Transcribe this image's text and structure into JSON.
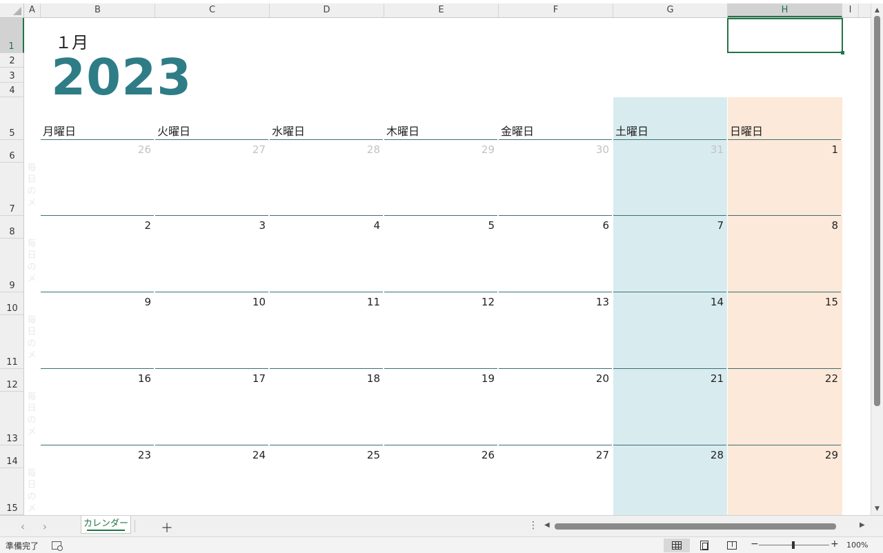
{
  "columns": [
    "A",
    "B",
    "C",
    "D",
    "E",
    "F",
    "G",
    "H",
    "I"
  ],
  "selected_column": "H",
  "rows": [
    "1",
    "2",
    "3",
    "4",
    "5",
    "6",
    "7",
    "8",
    "9",
    "10",
    "11",
    "12",
    "13",
    "14",
    "15"
  ],
  "selected_row": "1",
  "calendar": {
    "month": "１月",
    "year": "2023",
    "weekdays": [
      "月曜日",
      "火曜日",
      "水曜日",
      "木曜日",
      "金曜日",
      "土曜日",
      "日曜日"
    ],
    "weeks": [
      [
        {
          "d": "26",
          "faded": true
        },
        {
          "d": "27",
          "faded": true
        },
        {
          "d": "28",
          "faded": true
        },
        {
          "d": "29",
          "faded": true
        },
        {
          "d": "30",
          "faded": true
        },
        {
          "d": "31",
          "faded": true
        },
        {
          "d": "1"
        }
      ],
      [
        {
          "d": "2"
        },
        {
          "d": "3"
        },
        {
          "d": "4"
        },
        {
          "d": "5"
        },
        {
          "d": "6"
        },
        {
          "d": "7"
        },
        {
          "d": "8"
        }
      ],
      [
        {
          "d": "9"
        },
        {
          "d": "10"
        },
        {
          "d": "11"
        },
        {
          "d": "12"
        },
        {
          "d": "13"
        },
        {
          "d": "14"
        },
        {
          "d": "15"
        }
      ],
      [
        {
          "d": "16"
        },
        {
          "d": "17"
        },
        {
          "d": "18"
        },
        {
          "d": "19"
        },
        {
          "d": "20"
        },
        {
          "d": "21"
        },
        {
          "d": "22"
        }
      ],
      [
        {
          "d": "23"
        },
        {
          "d": "24"
        },
        {
          "d": "25"
        },
        {
          "d": "26"
        },
        {
          "d": "27"
        },
        {
          "d": "28"
        },
        {
          "d": "29"
        }
      ]
    ],
    "side_note": "毎日のメ"
  },
  "colors": {
    "year": "#2e7d86",
    "saturday_bg": "#d8ecef",
    "sunday_bg": "#fde9d9",
    "accent": "#217346"
  },
  "tabs": {
    "prev_icon": "‹",
    "next_icon": "›",
    "sheet_name": "カレンダー",
    "add_icon": "＋",
    "more_icon": "⋮",
    "scroll_left_icon": "◀",
    "scroll_right_icon": "▶"
  },
  "vscroll": {
    "up_icon": "▲",
    "down_icon": "▼"
  },
  "status": {
    "ready": "準備完了",
    "zoom": "100%",
    "zoom_minus": "−",
    "zoom_plus": "+"
  }
}
